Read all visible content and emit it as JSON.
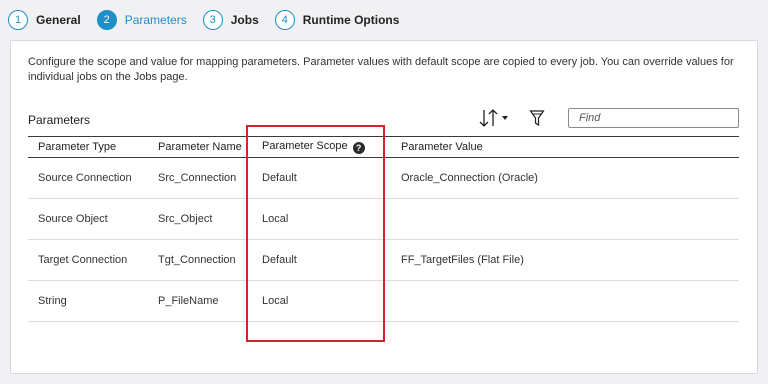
{
  "stepper": {
    "steps": [
      {
        "num": "1",
        "label": "General"
      },
      {
        "num": "2",
        "label": "Parameters"
      },
      {
        "num": "3",
        "label": "Jobs"
      },
      {
        "num": "4",
        "label": "Runtime Options"
      }
    ],
    "active_step": 2
  },
  "panel": {
    "description": "Configure the scope and value for mapping parameters. Parameter values with default scope are copied to every job. You can override values for individual jobs on the Jobs page.",
    "section_title": "Parameters",
    "find_placeholder": "Find",
    "find_value": ""
  },
  "table": {
    "headers": [
      "Parameter Type",
      "Parameter Name",
      "Parameter Scope",
      "Parameter Value"
    ],
    "help_icon": "?",
    "rows": [
      [
        "Source Connection",
        "Src_Connection",
        "Default",
        "Oracle_Connection (Oracle)"
      ],
      [
        "Source Object",
        "Src_Object",
        "Local",
        ""
      ],
      [
        "Target Connection",
        "Tgt_Connection",
        "Default",
        "FF_TargetFiles (Flat File)"
      ],
      [
        "String",
        "P_FileName",
        "Local",
        ""
      ]
    ]
  },
  "colors": {
    "accent": "#1d8fc9",
    "highlight": "#d6222f"
  },
  "icons": {
    "sort": "sort-icon",
    "filter": "filter-icon",
    "help": "help-icon"
  }
}
